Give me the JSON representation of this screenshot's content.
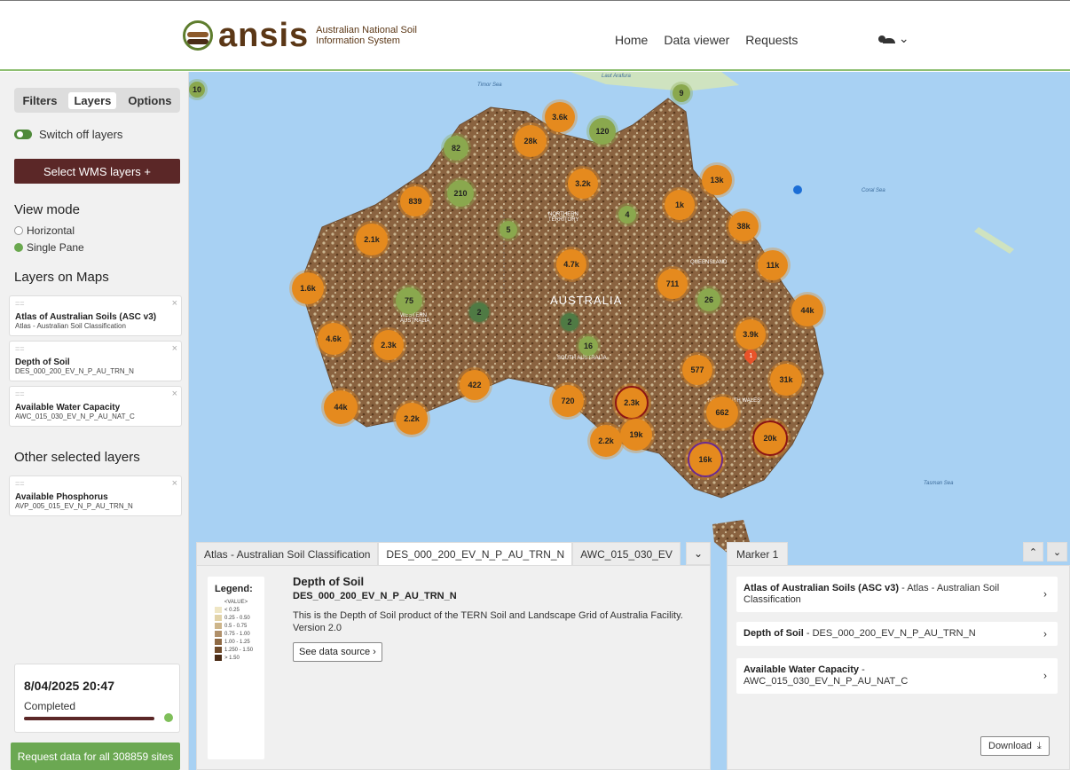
{
  "header": {
    "logo_word": "ansis",
    "logo_sub": "Australian National Soil Information System",
    "nav": [
      "Home",
      "Data viewer",
      "Requests"
    ]
  },
  "sidebar": {
    "tabs": [
      "Filters",
      "Layers",
      "Options"
    ],
    "active_tab": "Layers",
    "switch_label": "Switch off layers",
    "wms_button": "Select WMS layers  +",
    "view_mode_title": "View mode",
    "view_modes": [
      "Horizontal",
      "Single Pane"
    ],
    "selected_view_mode": "Single Pane",
    "layers_title": "Layers on Maps",
    "layers": [
      {
        "name": "Atlas of Australian Soils (ASC v3)",
        "code": "Atlas - Australian Soil Classification"
      },
      {
        "name": "Depth of Soil",
        "code": "DES_000_200_EV_N_P_AU_TRN_N"
      },
      {
        "name": "Available Water Capacity",
        "code": "AWC_015_030_EV_N_P_AU_NAT_C"
      }
    ],
    "other_title": "Other selected layers",
    "other_layers": [
      {
        "name": "Available Phosphorus",
        "code": "AVP_005_015_EV_N_P_AU_TRN_N"
      }
    ],
    "status": {
      "datetime": "8/04/2025 20:47",
      "label": "Completed",
      "progress": 1.0
    },
    "request_button": "Request data for all 308859 sites"
  },
  "map": {
    "sea_labels": [
      "Timor Sea",
      "Laut Arafura",
      "Coral Sea",
      "Tasman Sea"
    ],
    "place_labels": [
      "NORTHERN TERRITORY",
      "WESTERN AUSTRALIA",
      "QUEENSLAND",
      "SOUTH AUSTRALIA",
      "NEW SOUTH WALES"
    ],
    "country_label": "AUSTRALIA",
    "top_left_badge": "10",
    "clusters": [
      "9",
      "3.6k",
      "120",
      "28k",
      "82",
      "13k",
      "210",
      "839",
      "3.2k",
      "1k",
      "4",
      "38k",
      "5",
      "2.1k",
      "4.7k",
      "11k",
      "1.6k",
      "711",
      "26",
      "75",
      "2",
      "44k",
      "2",
      "3.9k",
      "4.6k",
      "2.3k",
      "16",
      "577",
      "31k",
      "422",
      "720",
      "2.3k",
      "662",
      "44k",
      "2.2k",
      "19k",
      "2.2k",
      "20k",
      "16k"
    ],
    "marker_label": "1"
  },
  "detail": {
    "tabs": [
      "Atlas - Australian Soil Classification",
      "DES_000_200_EV_N_P_AU_TRN_N",
      "AWC_015_030_EV"
    ],
    "active_tab": 1,
    "legend_title": "Legend:",
    "legend_value_label": "<VALUE>",
    "legend_items": [
      {
        "label": "< 0.25",
        "color": "#efe6c4"
      },
      {
        "label": "0.25 - 0.50",
        "color": "#e2d3a8"
      },
      {
        "label": "0.5 - 0.75",
        "color": "#cdb58a"
      },
      {
        "label": "0.75 - 1.00",
        "color": "#b0906a"
      },
      {
        "label": "1.00 - 1.25",
        "color": "#8f6a45"
      },
      {
        "label": "1.250 - 1.50",
        "color": "#6f4a2a"
      },
      {
        "label": "> 1.50",
        "color": "#4a2c16"
      }
    ],
    "title": "Depth of Soil",
    "code": "DES_000_200_EV_N_P_AU_TRN_N",
    "description": "This is the Depth of Soil product of the TERN Soil and Landscape Grid of Australia Facility. Version 2.0",
    "source_button": "See data source  ›"
  },
  "marker": {
    "tab": "Marker 1",
    "rows": [
      {
        "name": "Atlas of Australian Soils (ASC v3)",
        "rest": " - Atlas - Australian Soil Classification"
      },
      {
        "name": "Depth of Soil",
        "rest": " - DES_000_200_EV_N_P_AU_TRN_N"
      },
      {
        "name": "Available Water Capacity",
        "rest": " - AWC_015_030_EV_N_P_AU_NAT_C"
      }
    ],
    "download": "Download"
  }
}
